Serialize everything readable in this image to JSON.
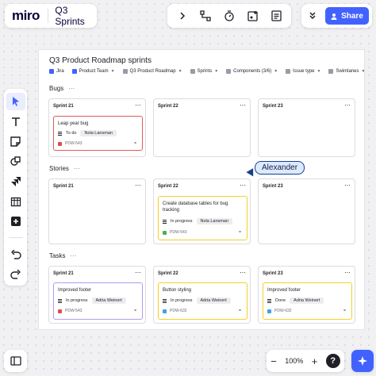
{
  "app": {
    "logo": "miro",
    "board_name": "Q3 Sprints"
  },
  "toolbar": {
    "share_label": "Share"
  },
  "zoom": {
    "level": "100%",
    "minus": "−",
    "plus": "+",
    "help": "?"
  },
  "board": {
    "title": "Q3 Product Roadmap sprints",
    "chips": [
      {
        "label": "Jira",
        "icon": "jira-icon"
      },
      {
        "label": "Product Team",
        "icon": "team-icon"
      },
      {
        "label": "Q3 Product Roadmap",
        "icon": "roadmap-icon"
      },
      {
        "label": "Sprints",
        "icon": "sprints-icon"
      },
      {
        "label": "Components (3/6)",
        "icon": "components-icon"
      },
      {
        "label": "Issue type",
        "icon": "issue-type-icon"
      },
      {
        "label": "Swimlanes",
        "icon": "swimlanes-icon"
      }
    ]
  },
  "sections": {
    "bugs": {
      "label": "Bugs",
      "more": "⋯",
      "columns": [
        {
          "head": "Sprint 21",
          "more": "⋯"
        },
        {
          "head": "Sprint 22",
          "more": "⋯"
        },
        {
          "head": "Sprint 23",
          "more": "⋯"
        }
      ],
      "card": {
        "title": "Leap year bug",
        "status": "To do",
        "assignee": "Nola Lansman",
        "key": "PDW-543",
        "color": "#e05b5b",
        "key_color": "#e34b4b"
      }
    },
    "stories": {
      "label": "Stories",
      "more": "⋯",
      "columns": [
        {
          "head": "Sprint 21",
          "more": "⋯"
        },
        {
          "head": "Sprint 22",
          "more": "⋯"
        },
        {
          "head": "Sprint 23",
          "more": "⋯"
        }
      ],
      "card": {
        "title": "Create database tables for bug tracking",
        "status": "In progress",
        "assignee": "Nola Lansman",
        "key": "PDW-543",
        "color": "#f2d024",
        "key_color": "#4caf50"
      }
    },
    "tasks": {
      "label": "Tasks",
      "more": "⋯",
      "columns": [
        {
          "head": "Sprint 21",
          "more": "⋯"
        },
        {
          "head": "Sprint 22",
          "more": "⋯"
        },
        {
          "head": "Sprint 23",
          "more": "⋯"
        }
      ],
      "cards": [
        {
          "title": "Improved footer",
          "status": "In progress",
          "assignee": "Adria Weinert",
          "key": "PDW-543",
          "color": "#b39af2",
          "key_color": "#e34b4b"
        },
        {
          "title": "Button styling",
          "status": "In progress",
          "assignee": "Adria Weinert",
          "key": "PDW-632",
          "color": "#f2d024",
          "key_color": "#3fa0e6"
        },
        {
          "title": "Improved footer",
          "status": "Done",
          "assignee": "Adria Weinert",
          "key": "PDW-632",
          "color": "#f2d024",
          "key_color": "#3fa0e6"
        }
      ]
    }
  },
  "cursor": {
    "name": "Alexander"
  },
  "colors": {
    "accent": "#4262ff"
  }
}
